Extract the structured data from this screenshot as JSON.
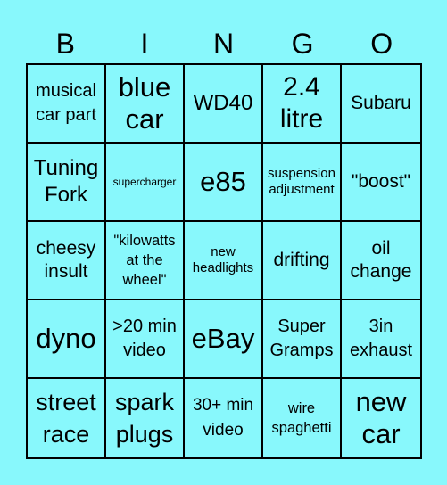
{
  "header": {
    "letters": [
      "B",
      "I",
      "N",
      "G",
      "O"
    ]
  },
  "colors": {
    "background": "#88f8fc",
    "grid_lines": "#000000"
  },
  "card": {
    "rows": [
      [
        "musical car part",
        "blue car",
        "WD40",
        "2.4 litre",
        "Subaru"
      ],
      [
        "Tuning Fork",
        "supercharger",
        "e85",
        "suspension adjustment",
        "\"boost\""
      ],
      [
        "cheesy insult",
        "\"kilowatts at the wheel\"",
        "new headlights",
        "drifting",
        "oil change"
      ],
      [
        "dyno",
        ">20 min video",
        "eBay",
        "Super Gramps",
        "3in exhaust"
      ],
      [
        "street race",
        "spark plugs",
        "30+ min video",
        "wire spaghetti",
        "new car"
      ]
    ]
  }
}
